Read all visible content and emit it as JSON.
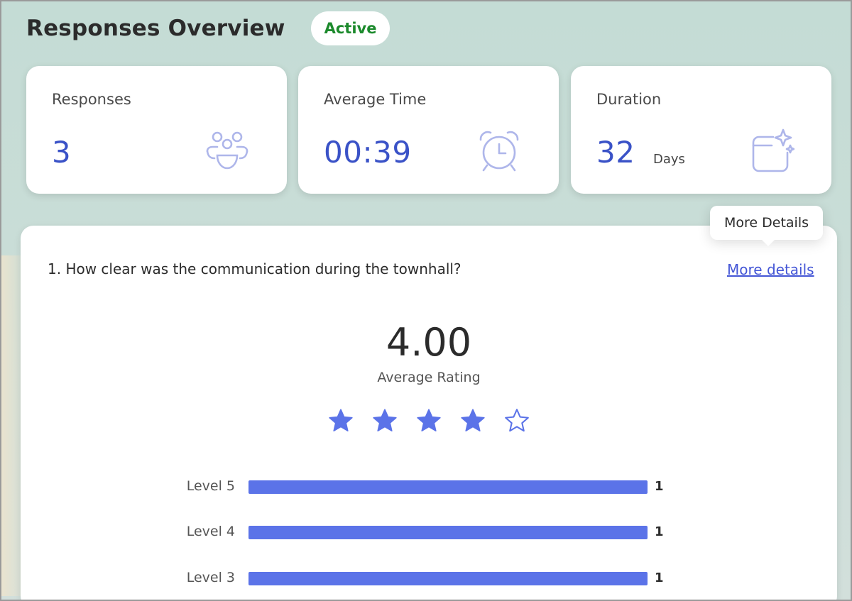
{
  "header": {
    "title": "Responses Overview",
    "status": "Active"
  },
  "stats": {
    "responses": {
      "label": "Responses",
      "value": "3",
      "icon": "people-group-icon"
    },
    "average_time": {
      "label": "Average Time",
      "value": "00:39",
      "icon": "alarm-clock-icon"
    },
    "duration": {
      "label": "Duration",
      "value": "32",
      "unit": "Days",
      "icon": "calendar-sparkle-icon"
    }
  },
  "tooltip": {
    "text": "More Details"
  },
  "question": {
    "text": "1. How clear was the communication during the townhall?",
    "more_link": "More details",
    "average_value": "4.00",
    "average_label": "Average Rating",
    "stars_filled": 4,
    "stars_total": 5,
    "levels": [
      {
        "label": "Level 5",
        "count": "1",
        "fraction": 1.0
      },
      {
        "label": "Level 4",
        "count": "1",
        "fraction": 1.0
      },
      {
        "label": "Level 3",
        "count": "1",
        "fraction": 1.0
      }
    ]
  },
  "colors": {
    "accent": "#3a52c7",
    "bar": "#5b73e8",
    "status_green": "#1c8a2c",
    "icon": "#aeb6ea"
  }
}
